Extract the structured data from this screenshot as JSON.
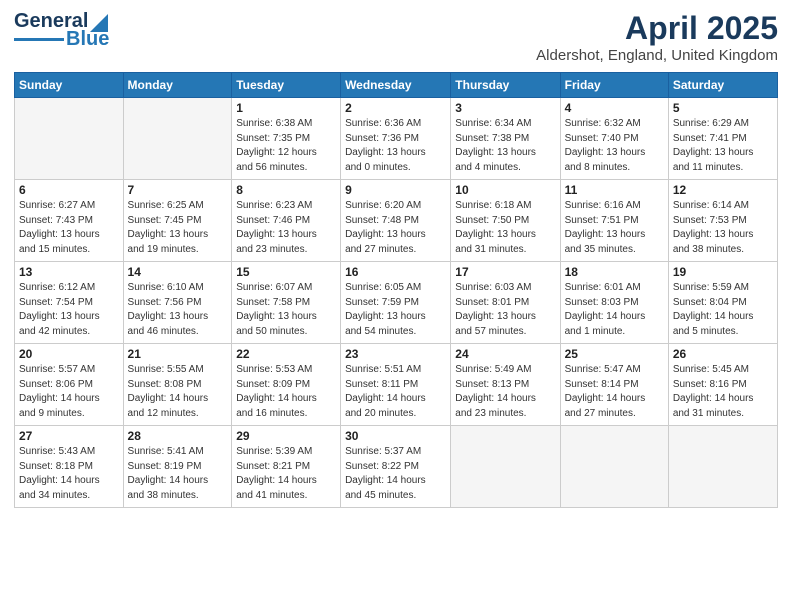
{
  "logo": {
    "text1": "General",
    "text2": "Blue"
  },
  "title": "April 2025",
  "subtitle": "Aldershot, England, United Kingdom",
  "days_of_week": [
    "Sunday",
    "Monday",
    "Tuesday",
    "Wednesday",
    "Thursday",
    "Friday",
    "Saturday"
  ],
  "weeks": [
    [
      {
        "day": "",
        "info": ""
      },
      {
        "day": "",
        "info": ""
      },
      {
        "day": "1",
        "info": "Sunrise: 6:38 AM\nSunset: 7:35 PM\nDaylight: 12 hours\nand 56 minutes."
      },
      {
        "day": "2",
        "info": "Sunrise: 6:36 AM\nSunset: 7:36 PM\nDaylight: 13 hours\nand 0 minutes."
      },
      {
        "day": "3",
        "info": "Sunrise: 6:34 AM\nSunset: 7:38 PM\nDaylight: 13 hours\nand 4 minutes."
      },
      {
        "day": "4",
        "info": "Sunrise: 6:32 AM\nSunset: 7:40 PM\nDaylight: 13 hours\nand 8 minutes."
      },
      {
        "day": "5",
        "info": "Sunrise: 6:29 AM\nSunset: 7:41 PM\nDaylight: 13 hours\nand 11 minutes."
      }
    ],
    [
      {
        "day": "6",
        "info": "Sunrise: 6:27 AM\nSunset: 7:43 PM\nDaylight: 13 hours\nand 15 minutes."
      },
      {
        "day": "7",
        "info": "Sunrise: 6:25 AM\nSunset: 7:45 PM\nDaylight: 13 hours\nand 19 minutes."
      },
      {
        "day": "8",
        "info": "Sunrise: 6:23 AM\nSunset: 7:46 PM\nDaylight: 13 hours\nand 23 minutes."
      },
      {
        "day": "9",
        "info": "Sunrise: 6:20 AM\nSunset: 7:48 PM\nDaylight: 13 hours\nand 27 minutes."
      },
      {
        "day": "10",
        "info": "Sunrise: 6:18 AM\nSunset: 7:50 PM\nDaylight: 13 hours\nand 31 minutes."
      },
      {
        "day": "11",
        "info": "Sunrise: 6:16 AM\nSunset: 7:51 PM\nDaylight: 13 hours\nand 35 minutes."
      },
      {
        "day": "12",
        "info": "Sunrise: 6:14 AM\nSunset: 7:53 PM\nDaylight: 13 hours\nand 38 minutes."
      }
    ],
    [
      {
        "day": "13",
        "info": "Sunrise: 6:12 AM\nSunset: 7:54 PM\nDaylight: 13 hours\nand 42 minutes."
      },
      {
        "day": "14",
        "info": "Sunrise: 6:10 AM\nSunset: 7:56 PM\nDaylight: 13 hours\nand 46 minutes."
      },
      {
        "day": "15",
        "info": "Sunrise: 6:07 AM\nSunset: 7:58 PM\nDaylight: 13 hours\nand 50 minutes."
      },
      {
        "day": "16",
        "info": "Sunrise: 6:05 AM\nSunset: 7:59 PM\nDaylight: 13 hours\nand 54 minutes."
      },
      {
        "day": "17",
        "info": "Sunrise: 6:03 AM\nSunset: 8:01 PM\nDaylight: 13 hours\nand 57 minutes."
      },
      {
        "day": "18",
        "info": "Sunrise: 6:01 AM\nSunset: 8:03 PM\nDaylight: 14 hours\nand 1 minute."
      },
      {
        "day": "19",
        "info": "Sunrise: 5:59 AM\nSunset: 8:04 PM\nDaylight: 14 hours\nand 5 minutes."
      }
    ],
    [
      {
        "day": "20",
        "info": "Sunrise: 5:57 AM\nSunset: 8:06 PM\nDaylight: 14 hours\nand 9 minutes."
      },
      {
        "day": "21",
        "info": "Sunrise: 5:55 AM\nSunset: 8:08 PM\nDaylight: 14 hours\nand 12 minutes."
      },
      {
        "day": "22",
        "info": "Sunrise: 5:53 AM\nSunset: 8:09 PM\nDaylight: 14 hours\nand 16 minutes."
      },
      {
        "day": "23",
        "info": "Sunrise: 5:51 AM\nSunset: 8:11 PM\nDaylight: 14 hours\nand 20 minutes."
      },
      {
        "day": "24",
        "info": "Sunrise: 5:49 AM\nSunset: 8:13 PM\nDaylight: 14 hours\nand 23 minutes."
      },
      {
        "day": "25",
        "info": "Sunrise: 5:47 AM\nSunset: 8:14 PM\nDaylight: 14 hours\nand 27 minutes."
      },
      {
        "day": "26",
        "info": "Sunrise: 5:45 AM\nSunset: 8:16 PM\nDaylight: 14 hours\nand 31 minutes."
      }
    ],
    [
      {
        "day": "27",
        "info": "Sunrise: 5:43 AM\nSunset: 8:18 PM\nDaylight: 14 hours\nand 34 minutes."
      },
      {
        "day": "28",
        "info": "Sunrise: 5:41 AM\nSunset: 8:19 PM\nDaylight: 14 hours\nand 38 minutes."
      },
      {
        "day": "29",
        "info": "Sunrise: 5:39 AM\nSunset: 8:21 PM\nDaylight: 14 hours\nand 41 minutes."
      },
      {
        "day": "30",
        "info": "Sunrise: 5:37 AM\nSunset: 8:22 PM\nDaylight: 14 hours\nand 45 minutes."
      },
      {
        "day": "",
        "info": ""
      },
      {
        "day": "",
        "info": ""
      },
      {
        "day": "",
        "info": ""
      }
    ]
  ]
}
